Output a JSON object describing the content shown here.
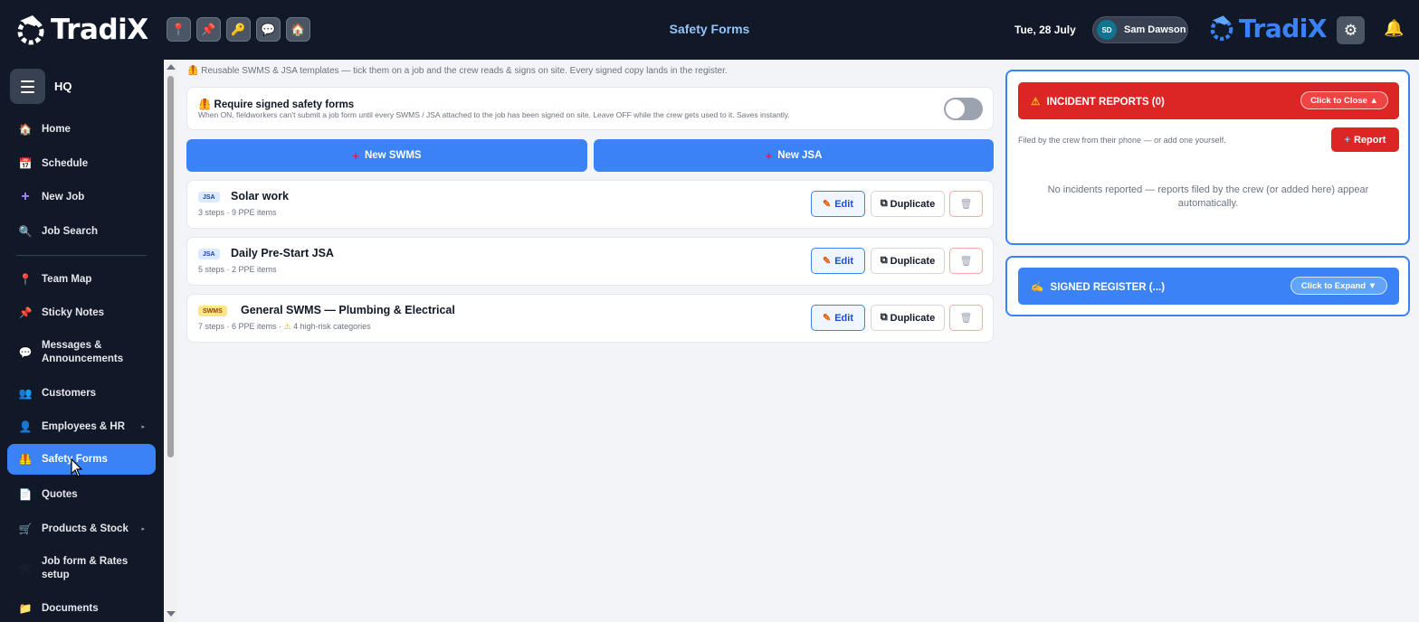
{
  "app": {
    "logo_text": "TradiX",
    "page_title": "Safety Forms",
    "date": "Tue, 28 July",
    "user": {
      "initials": "SD",
      "name": "Sam Dawson"
    },
    "quick_icons": [
      "pin-icon",
      "pushpin-icon",
      "key-icon",
      "chat-icon",
      "house-icon"
    ],
    "brand_right": "TradiX"
  },
  "sidebar": {
    "section": "HQ",
    "items": [
      {
        "label": "Home",
        "icon": "house-icon"
      },
      {
        "label": "Schedule",
        "icon": "calendar-icon"
      },
      {
        "label": "New Job",
        "icon": "plus-icon"
      },
      {
        "label": "Job Search",
        "icon": "magnifier-icon"
      },
      {
        "label": "Team Map",
        "icon": "pin-icon"
      },
      {
        "label": "Sticky Notes",
        "icon": "pushpin-icon"
      },
      {
        "label": "Messages & Announcements",
        "icon": "chat-icon"
      },
      {
        "label": "Customers",
        "icon": "people-icon"
      },
      {
        "label": "Employees & HR",
        "icon": "person-icon",
        "has_submenu": true
      },
      {
        "label": "Safety Forms",
        "icon": "safety-vest-icon",
        "active": true
      },
      {
        "label": "Quotes",
        "icon": "document-icon"
      },
      {
        "label": "Products & Stock",
        "icon": "cart-icon",
        "has_submenu": true
      },
      {
        "label": "Job form & Rates setup",
        "icon": "tools-icon"
      },
      {
        "label": "Documents",
        "icon": "folder-icon"
      }
    ]
  },
  "main": {
    "intro": "Reusable SWMS & JSA templates — tick them on a job and the crew reads & signs on site. Every signed copy lands in the register.",
    "require_signed": {
      "title": "Require signed safety forms",
      "description": "When ON, fieldworkers can't submit a job form until every SWMS / JSA attached to the job has been signed on site. Leave OFF while the crew gets used to it. Saves instantly.",
      "enabled": false
    },
    "new_swms_label": "New SWMS",
    "new_jsa_label": "New JSA",
    "templates": [
      {
        "type": "JSA",
        "title": "Solar work",
        "meta": "3 steps · 9 PPE items",
        "high_risk": ""
      },
      {
        "type": "JSA",
        "title": "Daily Pre-Start JSA",
        "meta": "5 steps · 2 PPE items",
        "high_risk": ""
      },
      {
        "type": "SWMS",
        "title": "General SWMS — Plumbing & Electrical",
        "meta": "7 steps · 6 PPE items ·",
        "high_risk": "4 high-risk categories"
      }
    ],
    "edit_label": "Edit",
    "duplicate_label": "Duplicate"
  },
  "incidents": {
    "title": "INCIDENT REPORTS (0)",
    "toggle_label": "Click to Close ▲",
    "note": "Filed by the crew from their phone — or add one yourself.",
    "report_label": "Report",
    "empty": "No incidents reported — reports filed by the crew (or added here) appear automatically."
  },
  "register": {
    "title": "SIGNED REGISTER (...)",
    "toggle_label": "Click to Expand ▼"
  },
  "colors": {
    "topbar": "#111827",
    "accent": "#3b82f6",
    "danger": "#dc2626"
  }
}
